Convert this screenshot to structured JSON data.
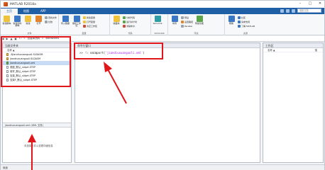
{
  "window": {
    "title": "MATLAB R2018a"
  },
  "tabs": [
    {
      "label": "主页",
      "active": true
    },
    {
      "label": "绘图",
      "active": false
    },
    {
      "label": "APP",
      "active": false
    }
  ],
  "search": {
    "placeholder": "搜索文档"
  },
  "ribbon": {
    "file": {
      "label": "文件",
      "new_script": "新建脚本",
      "new_live_script": "新建实时脚本",
      "new": "新建",
      "open": "打开",
      "find_files": "查找文件",
      "compare": "比较"
    },
    "variable": {
      "label": "变量",
      "import": "导入数据",
      "save": "保存工作区",
      "new_var": "新建变量",
      "open_var": "打开变量",
      "clear": "清空工作区"
    },
    "code": {
      "label": "代码",
      "favorites": "收藏夹",
      "analyze": "分析代码",
      "run_time": "运行并计时",
      "clear_cmd": "清除命令"
    },
    "simulink": {
      "label": "SIMULINK",
      "simulink": "Simulink"
    },
    "environment": {
      "label": "环境",
      "layout": "布局",
      "prefs": "预设",
      "set_path": "设置路径",
      "parallel": "Parallel",
      "addons": "附加功能"
    },
    "resources": {
      "label": "资源",
      "help": "帮助",
      "community": "社区",
      "support": "请求支持",
      "learn": "了解 MATLAB"
    }
  },
  "address": {
    "path": [
      "C:",
      "▸",
      "自建库资料",
      "▸",
      "solidworks"
    ]
  },
  "current_folder": {
    "title": "当前文件夹",
    "column": "名称 ▲",
    "files": [
      {
        "name": "-3jiandiuxuanguoli.SLDASM",
        "type": "asm",
        "selected": false
      },
      {
        "name": "jiandiuxuanguoli.SLDASM",
        "type": "asm",
        "selected": false
      },
      {
        "name": "jiandiuxuanguoli.xml",
        "type": "xml",
        "selected": true
      },
      {
        "name": "底座_默认_sldprt.STEP",
        "type": "step",
        "selected": false
      },
      {
        "name": "臂杆_默认_sldprt.STEP",
        "type": "step",
        "selected": false
      },
      {
        "name": "支架_默认_sldprt.STEP",
        "type": "step",
        "selected": false
      },
      {
        "name": "支架F_默认_sldprt.STEP",
        "type": "step",
        "selected": false
      }
    ],
    "detail_title": "jiandiuxuanguoli.xml (XML 文件)",
    "detail_note": "未选择文件以查看详细信息"
  },
  "command_window": {
    "title": "命令行窗口",
    "prompt": ">>",
    "fx": "fx",
    "command_fn": "smimport(",
    "command_arg": "'jiandiuxuanguoli.xml'",
    "command_end": ")"
  },
  "workspace": {
    "title": "工作区",
    "col_name": "名称 ▲",
    "col_value": "值"
  },
  "status": {
    "text": "就绪"
  },
  "colors": {
    "annotation": "#e0161b",
    "tab_bar": "#1f5fa6"
  }
}
